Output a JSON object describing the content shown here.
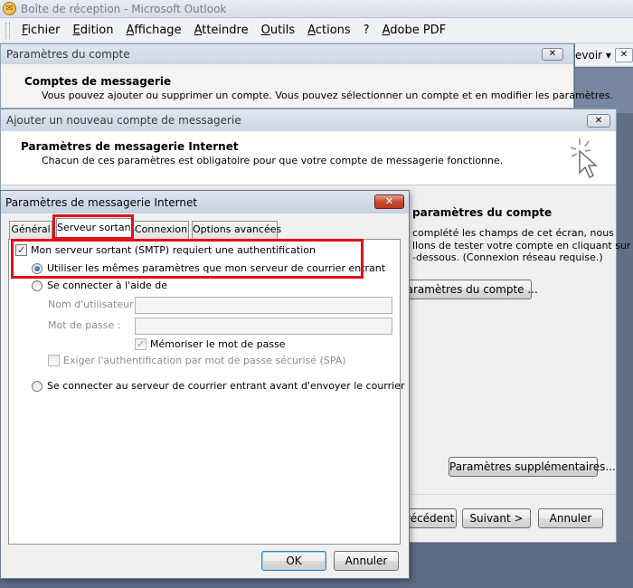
{
  "outlook": {
    "title": "Boîte de réception - Microsoft Outlook",
    "menu": [
      "Fichier",
      "Edition",
      "Affichage",
      "Atteindre",
      "Outils",
      "Actions",
      "?",
      "Adobe PDF"
    ],
    "toolbar_right_label": "evoir ▾",
    "toolbar_right_close": "✕"
  },
  "account_window": {
    "title": "Paramètres du compte",
    "close_label": "✕",
    "heading": "Comptes de messagerie",
    "description": "Vous pouvez ajouter ou supprimer un compte. Vous pouvez sélectionner un compte et en modifier les paramètres."
  },
  "add_account_window": {
    "title": "Ajouter un nouveau compte de messagerie",
    "close_label": "✕",
    "heading": "Paramètres de messagerie Internet",
    "description": "Chacun de ces paramètres est obligatoire pour que votre compte de messagerie fonctionne.",
    "test_heading": "paramètres du compte",
    "test_line1": "complété les champs de cet écran, nous",
    "test_line2": "llons de tester votre compte en cliquant sur",
    "test_line3": "-dessous. (Connexion réseau requise.)",
    "test_button": "paramètres du compte ...",
    "more_settings_button": "Paramètres supplémentaires...",
    "previous_button": "Précédent",
    "next_button": "Suivant >",
    "cancel_button": "Annuler"
  },
  "internet_dialog": {
    "title": "Paramètres de messagerie Internet",
    "close_label": "✕",
    "tabs": [
      {
        "label": "Général",
        "active": false
      },
      {
        "label": "Serveur sortant",
        "active": true
      },
      {
        "label": "Connexion",
        "active": false
      },
      {
        "label": "Options avancées",
        "active": false
      }
    ],
    "smtp_auth_label": "Mon serveur sortant (SMTP) requiert une authentification",
    "smtp_auth_checked": true,
    "same_settings_label": "Utiliser les mêmes paramètres que mon serveur de courrier entrant",
    "same_settings_selected": true,
    "connect_with_label": "Se connecter à l'aide de",
    "username_label": "Nom d'utilisateur :",
    "username_value": "",
    "password_label": "Mot de passe :",
    "password_value": "",
    "remember_password_label": "Mémoriser le mot de passe",
    "remember_password_checked": true,
    "spa_label": "Exiger l'authentification par mot de passe sécurisé (SPA)",
    "spa_checked": false,
    "connect_before_label": "Se connecter au serveur de courrier entrant avant d'envoyer le courrier",
    "ok_button": "OK",
    "cancel_button": "Annuler"
  },
  "colors": {
    "highlight": "#e0101a",
    "titlebar": "#cdd6e2",
    "desktop": "#5f6f85"
  }
}
